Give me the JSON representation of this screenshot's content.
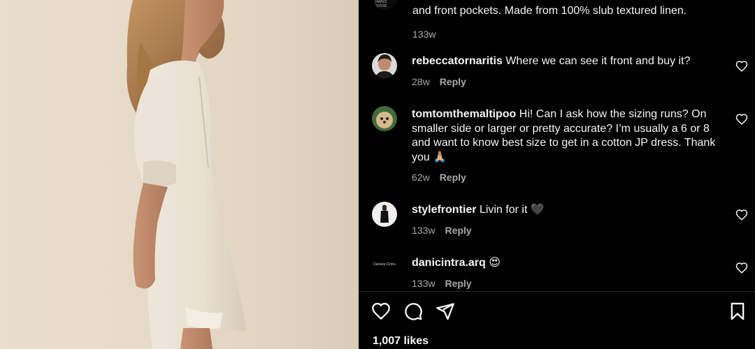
{
  "caption": {
    "avatar_text": "JAMES PERSE",
    "text_tail": "and front pockets. Made from 100% slub textured linen.",
    "time": "133w"
  },
  "comments": [
    {
      "username": "rebeccatornaritis",
      "text": "Where we can see it front and buy it?",
      "time": "28w",
      "reply_label": "Reply"
    },
    {
      "username": "tomtomthemaltipoo",
      "text": "Hi! Can I ask how the sizing runs? On smaller side or larger or pretty accurate? I’m usually a 6 or 8 and want to know best size to get in a cotton JP dress. Thank you 🙏🏼",
      "time": "62w",
      "reply_label": "Reply"
    },
    {
      "username": "stylefrontier",
      "text": "Livin for it 🖤",
      "time": "133w",
      "reply_label": "Reply"
    },
    {
      "username": "danicintra.arq",
      "text": "😍",
      "avatar_text": "Daniela Cintra",
      "time": "133w",
      "reply_label": "Reply"
    }
  ],
  "likes": "1,007 likes",
  "icons": {
    "like": "heart-icon",
    "comment": "comment-icon",
    "share": "share-icon",
    "save": "bookmark-icon",
    "comment_like": "heart-icon"
  }
}
